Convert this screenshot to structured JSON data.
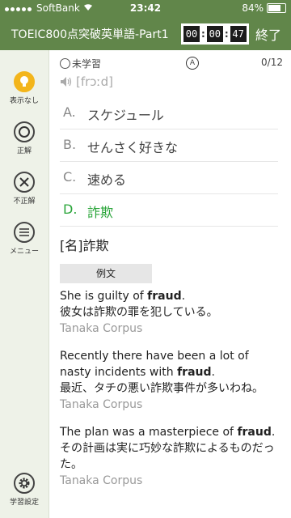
{
  "status": {
    "carrier": "SoftBank",
    "time": "23:42",
    "battery": "84%",
    "battery_level": 0.84
  },
  "header": {
    "title": "TOEIC800点突破英単語-Part1",
    "timer": [
      "00",
      "00",
      "47"
    ],
    "end_label": "終了"
  },
  "sidebar": {
    "items": [
      {
        "label": "表示なし",
        "icon": "lightbulb-icon"
      },
      {
        "label": "正解",
        "icon": "circle-icon"
      },
      {
        "label": "不正解",
        "icon": "x-icon"
      },
      {
        "label": "メニュー",
        "icon": "menu-icon"
      }
    ],
    "settings_label": "学習設定"
  },
  "quiz": {
    "status_label": "未学習",
    "badge": "A",
    "counter": "0/12",
    "pronunciation": "[frɔːd]",
    "choices": [
      {
        "letter": "A.",
        "text": "スケジュール"
      },
      {
        "letter": "B.",
        "text": "せんさく好きな"
      },
      {
        "letter": "C.",
        "text": "速める"
      },
      {
        "letter": "D.",
        "text": "詐欺",
        "correct": true
      }
    ],
    "meaning": "[名]詐欺",
    "examples_label": "例文"
  },
  "examples": [
    {
      "pre": "She is guilty of ",
      "word": "fraud",
      "post": ".",
      "ja": "彼女は詐欺の罪を犯している。",
      "source": "Tanaka Corpus"
    },
    {
      "pre": "Recently there have been a lot of nasty incidents with ",
      "word": "fraud",
      "post": ".",
      "ja": "最近、タチの悪い詐欺事件が多いわね。",
      "source": "Tanaka Corpus"
    },
    {
      "pre": "The plan was a masterpiece of ",
      "word": "fraud",
      "post": ".",
      "ja": "その計画は実に巧妙な詐欺によるものだった。",
      "source": "Tanaka Corpus"
    }
  ],
  "colors": {
    "header": "#61864a",
    "sidebar": "#eef2e8",
    "correct": "#2aa53a",
    "bulb": "#f3b51b"
  }
}
